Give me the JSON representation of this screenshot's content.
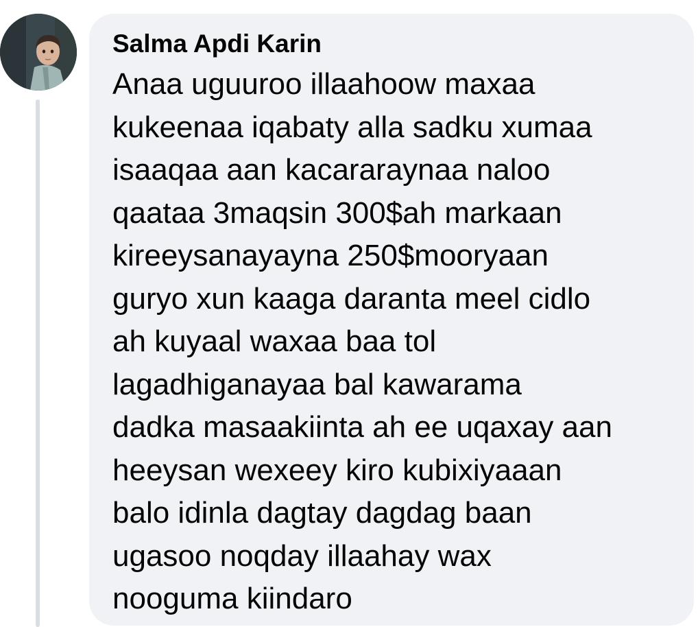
{
  "comment": {
    "author_name": "Salma Apdi Karin",
    "text": "Anaa uguuroo illaahoow maxaa\nkukeenaa iqabaty alla sadku xumaa\nisaaqaa aan kacararaynaa naloo\nqaataa 3maqsin 300$ah markaan\nkireeysanayayna 250$mooryaan\nguryo xun kaaga daranta meel cidlo\nah kuyaal waxaa baa tol\nlagadhiganayaa bal kawarama\ndadka masaakiinta ah ee uqaxay aan\nheeysan wexeey kiro kubixiyaaan\nbalo idinla dagtay dagdag baan\nugasoo noqday illaahay wax\nnooguma kiindaro"
  },
  "colors": {
    "bubble_background": "#f0f2f5",
    "text": "#050505",
    "thread_line": "#dadde1"
  }
}
